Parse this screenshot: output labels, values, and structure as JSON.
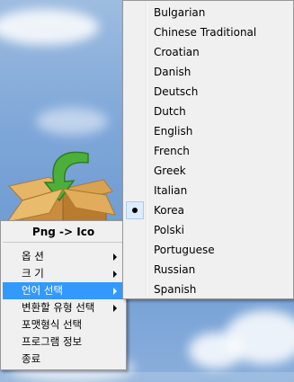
{
  "tray_menu": {
    "title": "Png -> Ico",
    "items": [
      {
        "label": "옵 션",
        "has_submenu": true
      },
      {
        "label": "크 기",
        "has_submenu": true
      },
      {
        "label": "언어 선택",
        "has_submenu": true,
        "highlighted": true
      },
      {
        "label": "변환할 유형 선택",
        "has_submenu": true
      },
      {
        "label": "포맷형식 선택",
        "has_submenu": false
      },
      {
        "label": "프로그램 정보",
        "has_submenu": false
      },
      {
        "label": "종료",
        "has_submenu": false
      }
    ]
  },
  "language_submenu": {
    "items": [
      "Bulgarian",
      "Chinese Traditional",
      "Croatian",
      "Danish",
      "Deutsch",
      "Dutch",
      "English",
      "French",
      "Greek",
      "Italian",
      "Korea",
      "Polski",
      "Portuguese",
      "Russian",
      "Spanish"
    ],
    "selected": "Korea"
  },
  "colors": {
    "highlight": "#3399ff",
    "menu_bg": "#f0f0f0",
    "arrow_icon": "#4caf3a",
    "box_icon": "#d9a250"
  }
}
